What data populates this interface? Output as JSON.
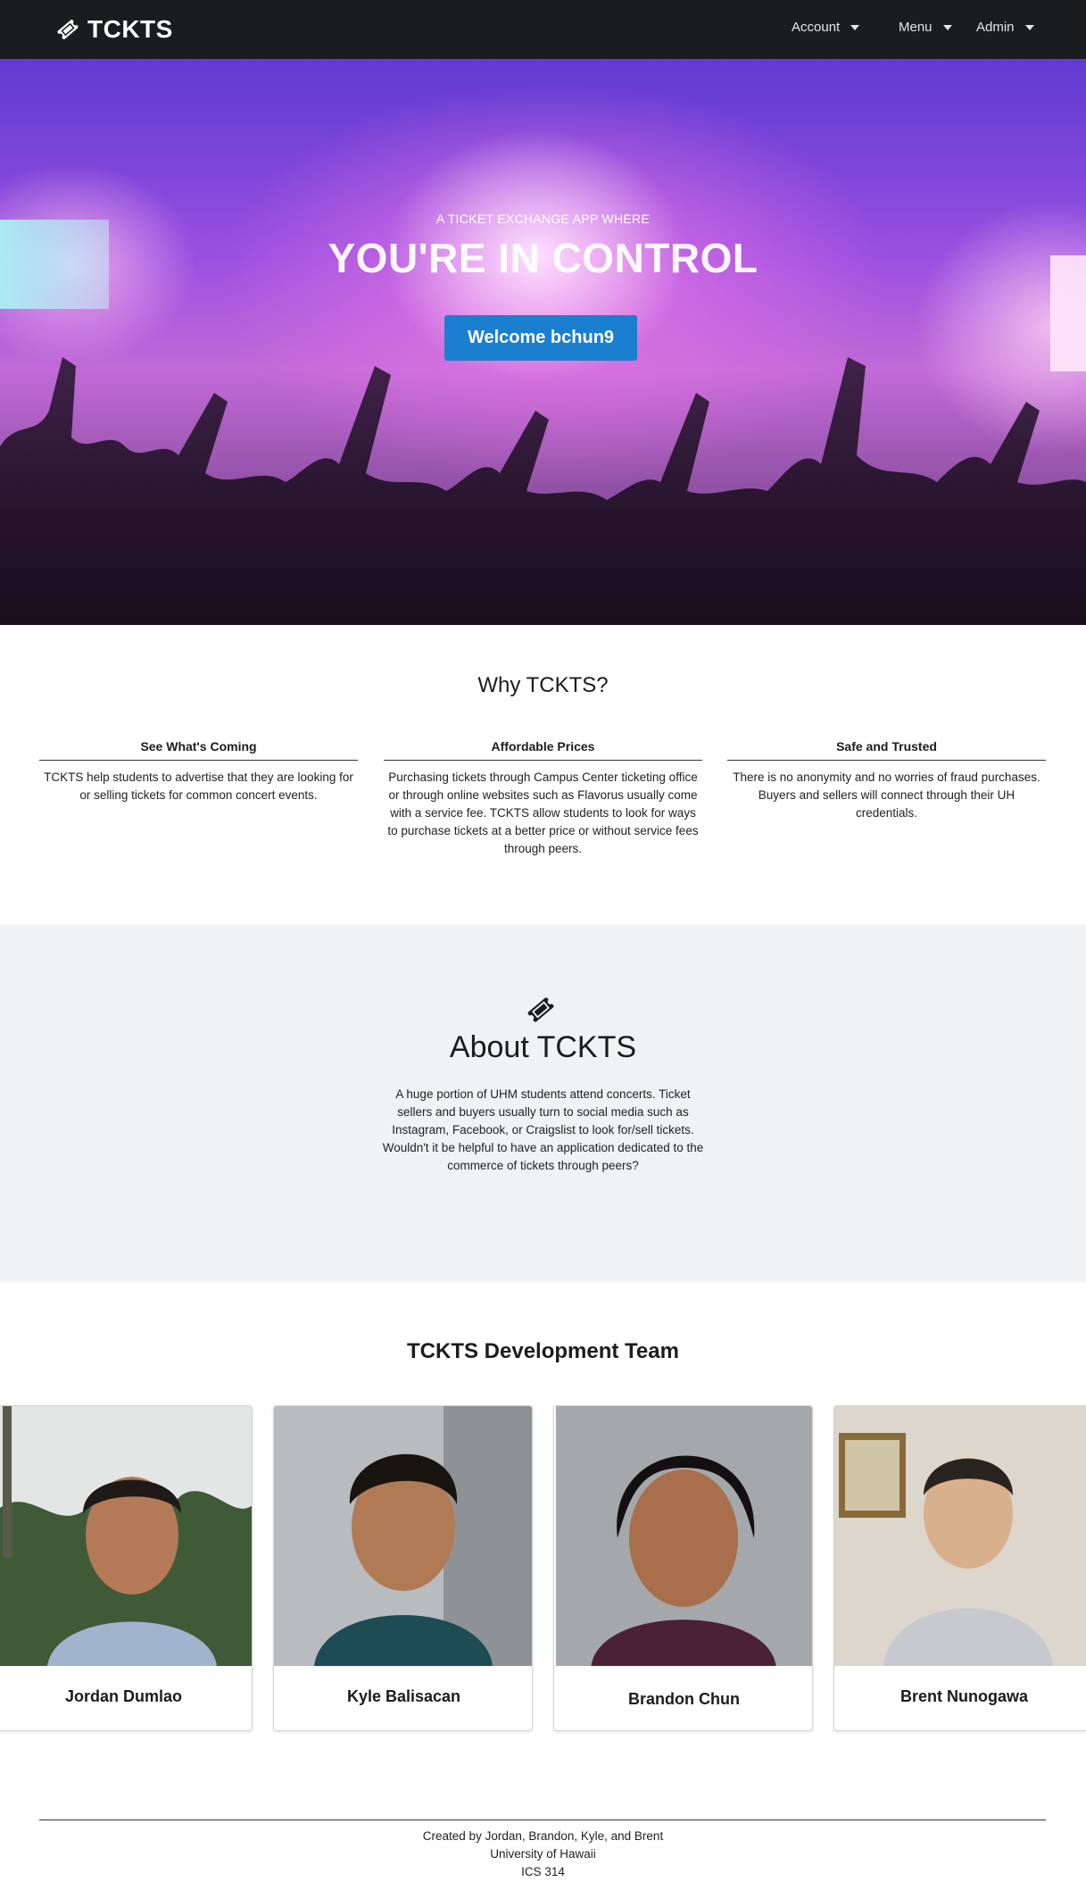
{
  "navbar": {
    "brand": "TCKTS",
    "brand_icon": "ticket-icon",
    "menus": [
      {
        "label": "Account"
      },
      {
        "label": "Menu"
      },
      {
        "label": "Admin"
      }
    ]
  },
  "hero": {
    "subtitle": "A TICKET EXCHANGE APP WHERE",
    "title": "YOU'RE IN CONTROL",
    "button_label": "Welcome bchun9",
    "button_color": "#1b7fcf"
  },
  "why": {
    "title": "Why TCKTS?",
    "columns": [
      {
        "heading": "See What's Coming",
        "body": "TCKTS help students to advertise that they are looking for or selling tickets for common concert events."
      },
      {
        "heading": "Affordable Prices",
        "body": "Purchasing tickets through Campus Center ticketing office or through online websites such as Flavorus usually come with a service fee. TCKTS allow students to look for ways to purchase tickets at a better price or without service fees through peers."
      },
      {
        "heading": "Safe and Trusted",
        "body": "There is no anonymity and no worries of fraud purchases. Buyers and sellers will connect through their UH credentials."
      }
    ]
  },
  "about": {
    "icon": "ticket-icon",
    "title": "About TCKTS",
    "body": "A huge portion of UHM students attend concerts. Ticket sellers and buyers usually turn to social media such as Instagram, Facebook, or Craigslist to look for/sell tickets. Wouldn't it be helpful to have an application dedicated to the commerce of tickets through peers?",
    "background": "#f1f2f4"
  },
  "team": {
    "title": "TCKTS Development Team",
    "members": [
      {
        "name": "Jordan Dumlao"
      },
      {
        "name": "Kyle Balisacan"
      },
      {
        "name": "Brandon Chun"
      },
      {
        "name": "Brent Nunogawa"
      }
    ]
  },
  "footer": {
    "line1": "Created by Jordan, Brandon, Kyle, and Brent",
    "line2": "University of Hawaii",
    "line3": "ICS 314"
  }
}
